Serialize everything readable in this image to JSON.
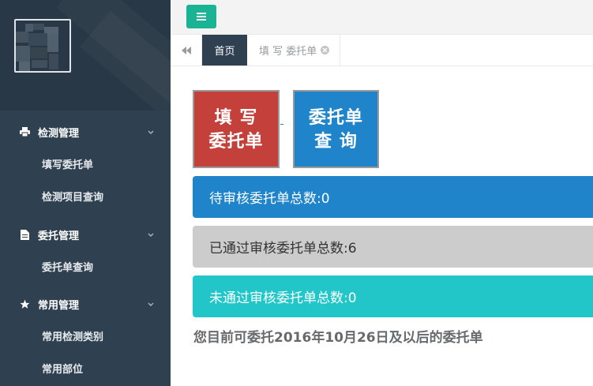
{
  "sidebar": {
    "groups": [
      {
        "label": "检测管理",
        "icon": "printer-icon",
        "items": [
          "填写委托单",
          "检测项目查询"
        ]
      },
      {
        "label": "委托管理",
        "icon": "document-icon",
        "items": [
          "委托单查询"
        ]
      },
      {
        "label": "常用管理",
        "icon": "star-icon",
        "items": [
          "常用检测类别",
          "常用部位"
        ]
      }
    ]
  },
  "topbar": {
    "menu_icon": "hamburger-icon"
  },
  "tabs": {
    "home": "首页",
    "form": "填 写 委托单"
  },
  "actions": {
    "fill_line1": "填 写",
    "fill_line2": "委托单",
    "query_line1": "委托单",
    "query_line2": "查 询"
  },
  "stats": {
    "pending": "待审核委托单总数:0",
    "passed": "已通过审核委托单总数:6",
    "failed": "未通过审核委托单总数:0"
  },
  "notice": "您目前可委托2016年10月26日及以后的委托单",
  "colors": {
    "sidebar": "#2f4050",
    "accent": "#1ab394",
    "red": "#c4403a",
    "blue": "#1f84c9",
    "teal": "#23c6c8",
    "gray": "#cccccc"
  }
}
